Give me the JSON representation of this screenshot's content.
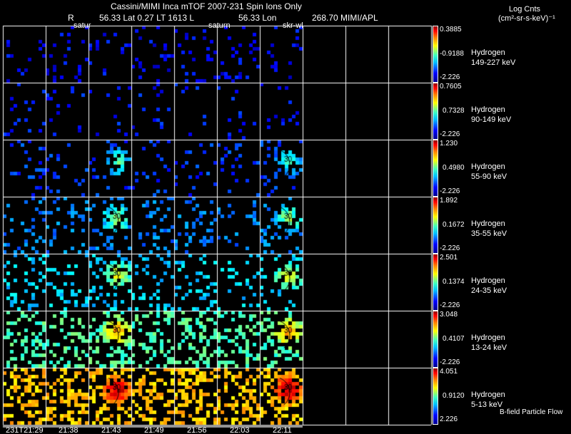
{
  "header": {
    "title": "Cassini/MIMI Inca mTOF  2007-231   Spin   Ions Only",
    "subtitle_r": "R",
    "subtitle_main": "56.33 Lat 0.27 LT 1613 L",
    "subtitle_l": "56.33 Lon",
    "subtitle_lon": "268.70  MIMI/APL",
    "overlay_labels": [
      "satur",
      "saturn",
      "skr-wl"
    ]
  },
  "units": {
    "line1": "Log Cnts",
    "line2": "(cm²-sr-s-keV)⁻¹"
  },
  "footer_note": "B-field Particle Flow",
  "chart_data": {
    "type": "heatmap",
    "colormap": "jet",
    "x_tick_labels": [
      "231T21:29",
      "21:38",
      "21:43",
      "21:49",
      "21:56",
      "22:03",
      "22:11"
    ],
    "columns": 10,
    "rows": [
      {
        "species": "Hydrogen",
        "energy": "149-227 keV",
        "max": "0.3885",
        "mid": "-0.9188",
        "min": "-2.226"
      },
      {
        "species": "Hydrogen",
        "energy": "90-149 keV",
        "max": "0.7605",
        "mid": "0.7328",
        "min": "-2.226"
      },
      {
        "species": "Hydrogen",
        "energy": "55-90 keV",
        "max": "1.230",
        "mid": "0.4980",
        "min": "-2.226"
      },
      {
        "species": "Hydrogen",
        "energy": "35-55 keV",
        "max": "1.892",
        "mid": "0.1672",
        "min": "-2.226"
      },
      {
        "species": "Hydrogen",
        "energy": "24-35 keV",
        "max": "2.501",
        "mid": "0.1374",
        "min": "-2.226"
      },
      {
        "species": "Hydrogen",
        "energy": "13-24 keV",
        "max": "3.048",
        "mid": "0.4107",
        "min": "-2.226"
      },
      {
        "species": "Hydrogen",
        "energy": "5-13 keV",
        "max": "4.051",
        "mid": "0.9120",
        "min": "2.226"
      }
    ],
    "contour_label": "30"
  }
}
